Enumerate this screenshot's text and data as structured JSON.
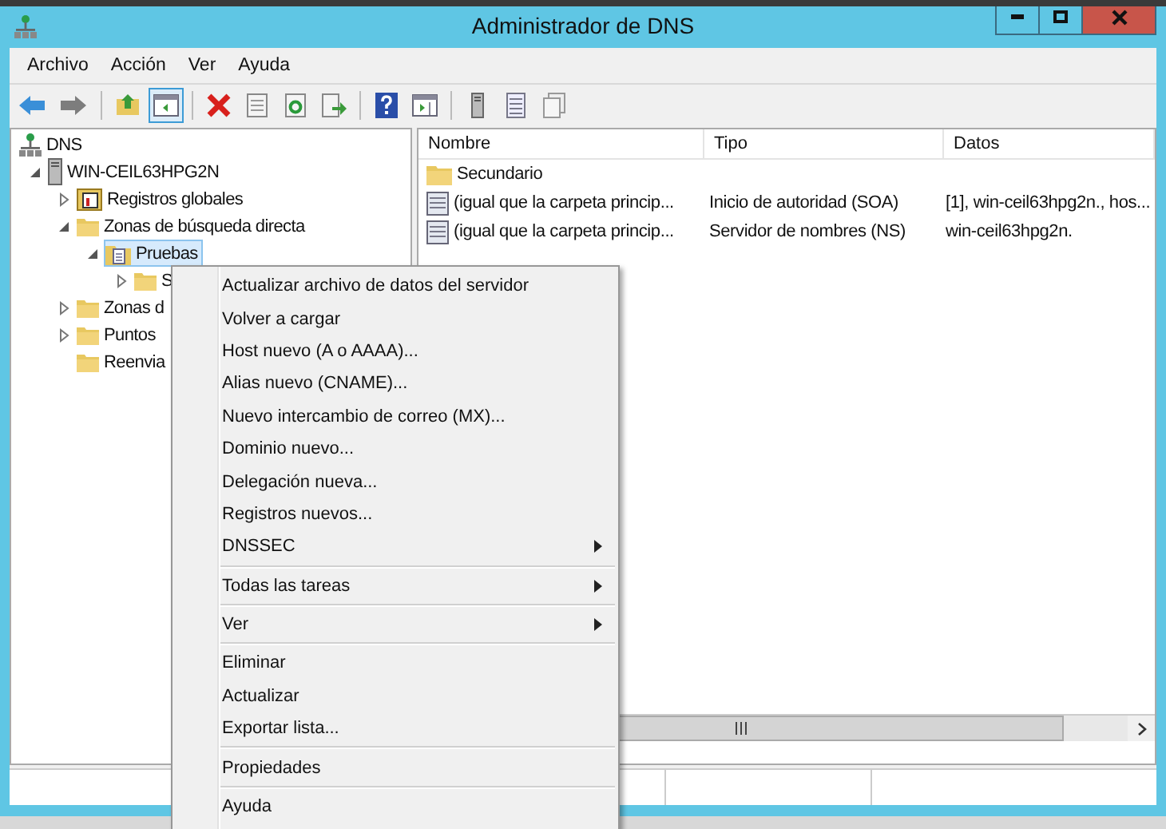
{
  "window": {
    "title": "Administrador de DNS"
  },
  "menu_bar": [
    "Archivo",
    "Acción",
    "Ver",
    "Ayuda"
  ],
  "toolbar": [
    {
      "kind": "back",
      "pressed": false
    },
    {
      "kind": "forward",
      "pressed": false
    },
    {
      "kind": "sep"
    },
    {
      "kind": "up",
      "pressed": false
    },
    {
      "kind": "tree",
      "pressed": true
    },
    {
      "kind": "sep"
    },
    {
      "kind": "delete",
      "pressed": false
    },
    {
      "kind": "properties",
      "pressed": false
    },
    {
      "kind": "refresh",
      "pressed": false
    },
    {
      "kind": "export",
      "pressed": false
    },
    {
      "kind": "sep"
    },
    {
      "kind": "help",
      "pressed": false
    },
    {
      "kind": "pane",
      "pressed": false
    },
    {
      "kind": "sep"
    },
    {
      "kind": "server",
      "pressed": false
    },
    {
      "kind": "list",
      "pressed": false
    },
    {
      "kind": "copy",
      "pressed": false
    }
  ],
  "tree": [
    {
      "label": "DNS",
      "kind": "dns",
      "selected": false,
      "children": [
        {
          "label": "WIN-CEIL63HPG2N",
          "kind": "server",
          "expanded": true,
          "selected": false,
          "children": [
            {
              "label": "Registros globales",
              "kind": "records",
              "expanded": false,
              "selected": false
            },
            {
              "label": "Zonas de búsqueda directa",
              "kind": "folder",
              "expanded": true,
              "selected": false,
              "children": [
                {
                  "label": "Pruebas",
                  "kind": "zone",
                  "expanded": true,
                  "selected": true,
                  "children": [
                    {
                      "label": "S",
                      "kind": "folder",
                      "expanded": false,
                      "selected": false
                    }
                  ]
                }
              ]
            },
            {
              "label": "Zonas d",
              "kind": "folder",
              "expanded": false,
              "selected": false
            },
            {
              "label": "Puntos",
              "kind": "folder",
              "expanded": false,
              "selected": false
            },
            {
              "label": "Reenvia",
              "kind": "folder",
              "selected": false
            }
          ]
        }
      ]
    }
  ],
  "table": {
    "columns": [
      "Nombre",
      "Tipo",
      "Datos"
    ],
    "rows": [
      {
        "kind": "folder",
        "cells": [
          "Secundario",
          "",
          ""
        ]
      },
      {
        "kind": "record",
        "cells": [
          "(igual que la carpeta princip...",
          "Inicio de autoridad (SOA)",
          "[1], win-ceil63hpg2n., hos..."
        ]
      },
      {
        "kind": "record",
        "cells": [
          "(igual que la carpeta princip...",
          "Servidor de nombres (NS)",
          "win-ceil63hpg2n."
        ]
      }
    ]
  },
  "context_menu": {
    "groups": [
      [
        {
          "label": "Actualizar archivo de datos del servidor",
          "submenu": false
        },
        {
          "label": "Volver a cargar",
          "submenu": false
        },
        {
          "label": "Host nuevo (A o AAAA)...",
          "submenu": false
        },
        {
          "label": "Alias nuevo (CNAME)...",
          "submenu": false
        },
        {
          "label": "Nuevo intercambio de correo (MX)...",
          "submenu": false
        },
        {
          "label": "Dominio nuevo...",
          "submenu": false
        },
        {
          "label": "Delegación nueva...",
          "submenu": false
        },
        {
          "label": "Registros nuevos...",
          "submenu": false
        },
        {
          "label": "DNSSEC",
          "submenu": true
        }
      ],
      [
        {
          "label": "Todas las tareas",
          "submenu": true
        }
      ],
      [
        {
          "label": "Ver",
          "submenu": true
        }
      ],
      [
        {
          "label": "Eliminar",
          "submenu": false
        },
        {
          "label": "Actualizar",
          "submenu": false
        },
        {
          "label": "Exportar lista...",
          "submenu": false
        }
      ],
      [
        {
          "label": "Propiedades",
          "submenu": false
        }
      ],
      [
        {
          "label": "Ayuda",
          "submenu": false
        }
      ]
    ]
  }
}
